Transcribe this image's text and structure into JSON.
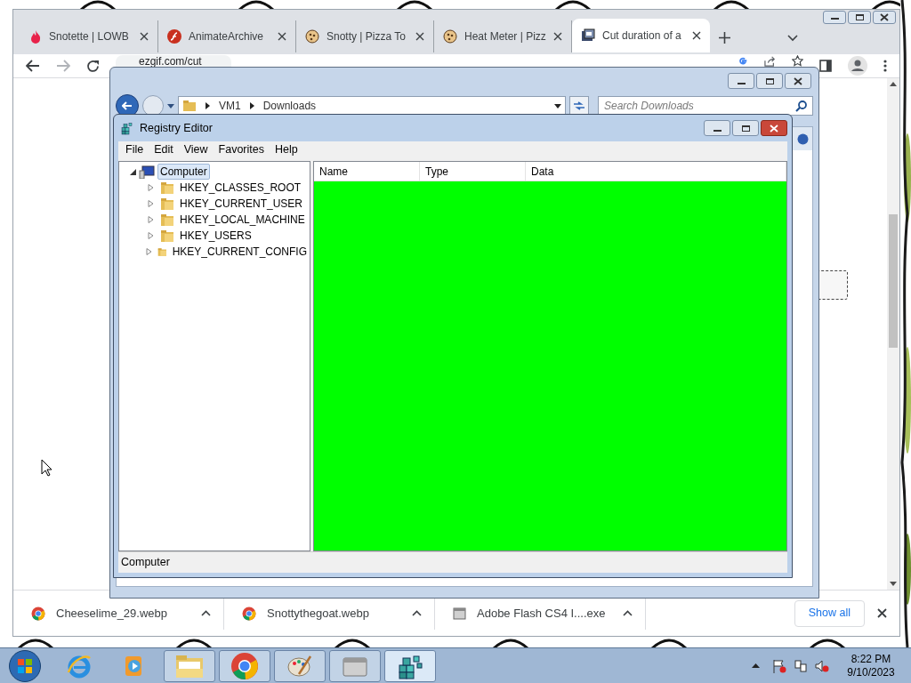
{
  "browser": {
    "tabs": [
      {
        "kind": "flame",
        "title": "Snotette | LOWB",
        "selected": false
      },
      {
        "kind": "flash",
        "title": "AnimateArchive",
        "selected": false
      },
      {
        "kind": "cookie",
        "title": "Snotty | Pizza To",
        "selected": false
      },
      {
        "kind": "cookie",
        "title": "Heat Meter | Pizz",
        "selected": false
      },
      {
        "kind": "film",
        "title": "Cut duration of a",
        "selected": true
      }
    ],
    "address": "ezgif.com/cut",
    "downloads": [
      {
        "name": "Cheeselime_29.webp"
      },
      {
        "name": "Snottythegoat.webp"
      },
      {
        "kind": "installer",
        "name": "Adobe Flash CS4 I....exe"
      }
    ],
    "show_all": "Show all"
  },
  "explorer": {
    "breadcrumb": [
      "VM1",
      "Downloads"
    ],
    "search": {
      "placeholder": "Search Downloads"
    }
  },
  "regedit": {
    "title": "Registry Editor",
    "menu": [
      "File",
      "Edit",
      "View",
      "Favorites",
      "Help"
    ],
    "tree": [
      {
        "label": "Computer",
        "expanded": true,
        "selected": true,
        "children": [
          {
            "label": "HKEY_CLASSES_ROOT",
            "expanded": false,
            "selected": false
          },
          {
            "label": "HKEY_CURRENT_USER",
            "expanded": false,
            "selected": false
          },
          {
            "label": "HKEY_LOCAL_MACHINE",
            "expanded": false,
            "selected": false
          },
          {
            "label": "HKEY_USERS",
            "expanded": false,
            "selected": false
          },
          {
            "label": "HKEY_CURRENT_CONFIG",
            "expanded": false,
            "selected": false
          }
        ]
      }
    ],
    "columns": [
      "Name",
      "Type",
      "Data"
    ],
    "status": "Computer"
  },
  "taskbar": {
    "apps": [
      {
        "kind": "ie",
        "open": false,
        "selected": false
      },
      {
        "kind": "media",
        "open": false,
        "selected": false
      },
      {
        "kind": "folder",
        "open": true,
        "selected": false
      },
      {
        "kind": "chrome",
        "open": true,
        "selected": false
      },
      {
        "kind": "paint",
        "open": true,
        "selected": false
      },
      {
        "kind": "adobe",
        "open": true,
        "selected": false
      },
      {
        "kind": "regedit",
        "open": true,
        "selected": true
      }
    ],
    "time": "8:22 PM",
    "date": "9/10/2023"
  }
}
